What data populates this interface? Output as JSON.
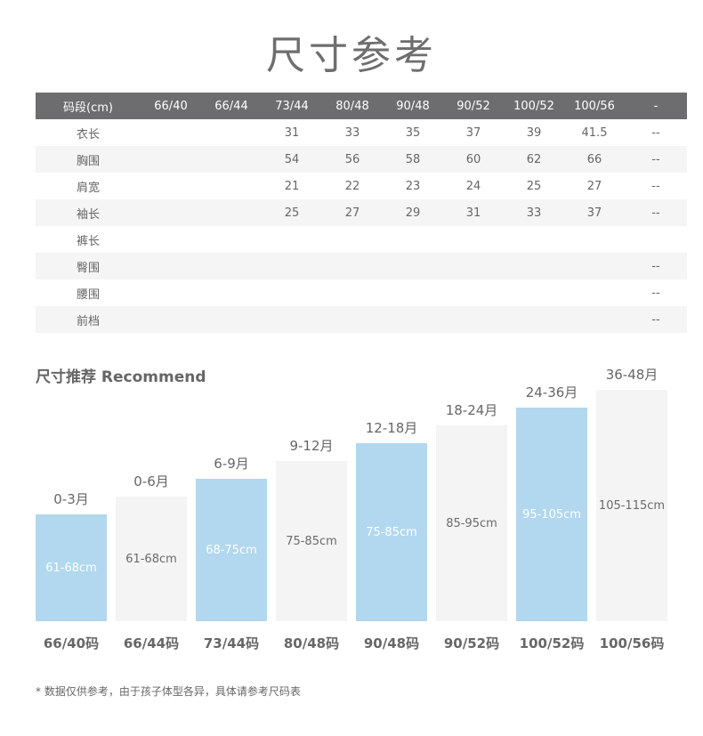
{
  "title": "尺寸参考",
  "size_table": {
    "headers": [
      "码段(cm)",
      "66/40",
      "66/44",
      "73/44",
      "80/48",
      "90/48",
      "90/52",
      "100/52",
      "100/56",
      "-"
    ],
    "rows": [
      {
        "label": "衣长",
        "values": [
          "",
          "",
          "31",
          "33",
          "35",
          "37",
          "39",
          "41.5",
          "--"
        ]
      },
      {
        "label": "胸围",
        "values": [
          "",
          "",
          "54",
          "56",
          "58",
          "60",
          "62",
          "66",
          "--"
        ]
      },
      {
        "label": "肩宽",
        "values": [
          "",
          "",
          "21",
          "22",
          "23",
          "24",
          "25",
          "27",
          "--"
        ]
      },
      {
        "label": "袖长",
        "values": [
          "",
          "",
          "25",
          "27",
          "29",
          "31",
          "33",
          "37",
          "--"
        ]
      },
      {
        "label": "裤长",
        "values": [
          "",
          "",
          "",
          "",
          "",
          "",
          "",
          "",
          ""
        ]
      },
      {
        "label": "臀围",
        "values": [
          "",
          "",
          "",
          "",
          "",
          "",
          "",
          "",
          "--"
        ]
      },
      {
        "label": "腰围",
        "values": [
          "",
          "",
          "",
          "",
          "",
          "",
          "",
          "",
          "--"
        ]
      },
      {
        "label": "前档",
        "values": [
          "",
          "",
          "",
          "",
          "",
          "",
          "",
          "",
          "--"
        ]
      }
    ]
  },
  "recommend": {
    "title": "尺寸推荐 Recommend",
    "colors": {
      "highlight": "#b1d8ee",
      "plain": "#f4f4f4"
    },
    "items": [
      {
        "age": "0-3月",
        "height": "61-68cm",
        "size": "66/40码",
        "highlight": true
      },
      {
        "age": "0-6月",
        "height": "61-68cm",
        "size": "66/44码",
        "highlight": false
      },
      {
        "age": "6-9月",
        "height": "68-75cm",
        "size": "73/44码",
        "highlight": true
      },
      {
        "age": "9-12月",
        "height": "75-85cm",
        "size": "80/48码",
        "highlight": false
      },
      {
        "age": "12-18月",
        "height": "75-85cm",
        "size": "90/48码",
        "highlight": true
      },
      {
        "age": "18-24月",
        "height": "85-95cm",
        "size": "90/52码",
        "highlight": false
      },
      {
        "age": "24-36月",
        "height": "95-105cm",
        "size": "100/52码",
        "highlight": true
      },
      {
        "age": "36-48月",
        "height": "105-115cm",
        "size": "100/56码",
        "highlight": false
      }
    ]
  },
  "footnote": "* 数据仅供参考，由于孩子体型各异，具体请参考尺码表"
}
